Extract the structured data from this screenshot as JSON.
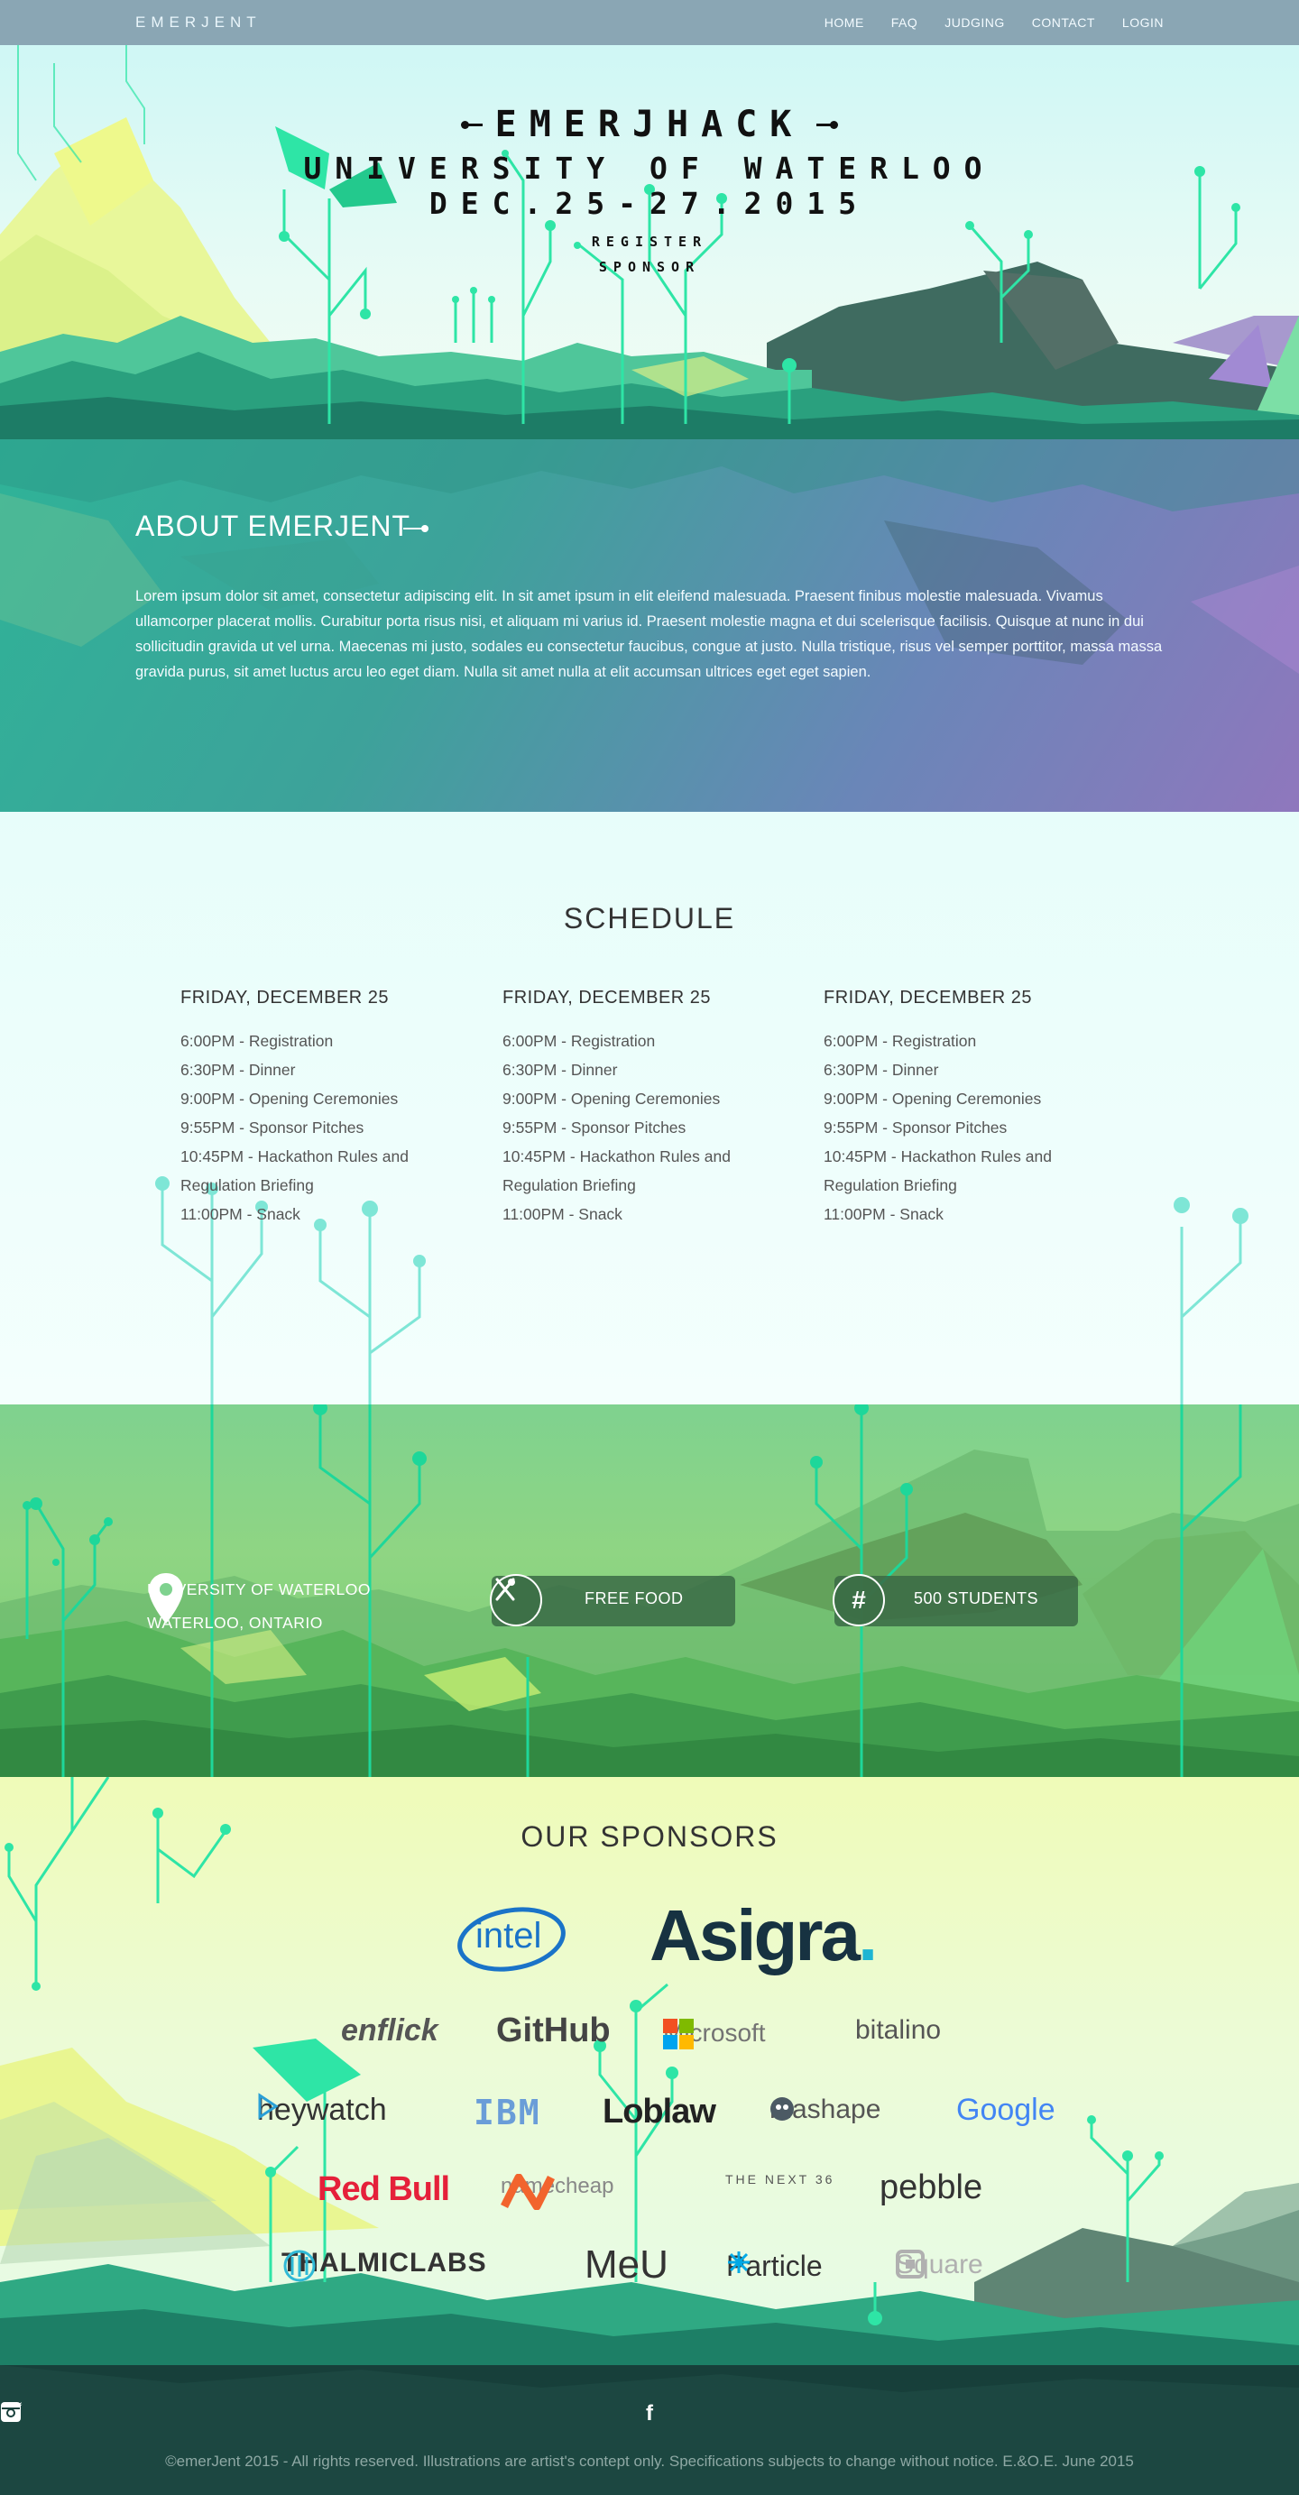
{
  "nav": {
    "brand": "EMERJENT",
    "items": [
      {
        "label": "HOME"
      },
      {
        "label": "FAQ"
      },
      {
        "label": "JUDGING"
      },
      {
        "label": "CONTACT"
      },
      {
        "label": "LOGIN"
      }
    ]
  },
  "hero": {
    "title": "EMERJHACK",
    "location": "UNIVERSITY OF WATERLOO",
    "dates": "DEC.25-27.2015",
    "register": "REGISTER",
    "sponsor": "SPONSOR"
  },
  "about": {
    "heading": "ABOUT EMERJENT",
    "body": "Lorem ipsum dolor sit amet, consectetur adipiscing elit. In sit amet ipsum in elit eleifend malesuada. Praesent finibus molestie malesuada. Vivamus ullamcorper placerat mollis. Curabitur porta risus nisi, et aliquam mi varius id. Praesent molestie magna et dui scelerisque facilisis. Quisque at nunc in dui sollicitudin gravida ut vel urna. Maecenas mi justo, sodales eu consectetur faucibus, congue at justo. Nulla tristique, risus vel semper porttitor, massa massa gravida purus, sit amet luctus arcu leo eget diam. Nulla sit amet nulla at elit accumsan ultrices eget eget sapien."
  },
  "schedule": {
    "heading": "SCHEDULE",
    "days": [
      {
        "title": "FRIDAY, DECEMBER 25",
        "events": [
          "6:00PM - Registration",
          "6:30PM - Dinner",
          "9:00PM - Opening Ceremonies",
          "9:55PM - Sponsor Pitches",
          "10:45PM - Hackathon Rules and Regulation Briefing",
          "11:00PM - Snack"
        ]
      },
      {
        "title": "FRIDAY, DECEMBER 25",
        "events": [
          "6:00PM - Registration",
          "6:30PM - Dinner",
          "9:00PM - Opening Ceremonies",
          "9:55PM - Sponsor Pitches",
          "10:45PM - Hackathon Rules and Regulation Briefing",
          "11:00PM - Snack"
        ]
      },
      {
        "title": "FRIDAY, DECEMBER 25",
        "events": [
          "6:00PM - Registration",
          "6:30PM - Dinner",
          "9:00PM - Opening Ceremonies",
          "9:55PM - Sponsor Pitches",
          "10:45PM - Hackathon Rules and Regulation Briefing",
          "11:00PM - Snack"
        ]
      }
    ]
  },
  "info": {
    "location_line1": "UNIVERSITY OF WATERLOO",
    "location_line2": "WATERLOO, ONTARIO",
    "food_label": "FREE FOOD",
    "students_label": "500 STUDENTS",
    "location_icon": "map-pin-icon",
    "food_icon": "fork-knife-icon",
    "students_icon": "hashtag-icon",
    "students_symbol": "#"
  },
  "sponsors": {
    "heading": "OUR SPONSORS",
    "names": {
      "intel": "intel",
      "asigra": "Asigra",
      "enflick": "enflick",
      "github": "GitHub",
      "microsoft": "Microsoft",
      "bitalino": "bitalino",
      "heywatch": "heywatch",
      "ibm": "IBM",
      "loblaw": "Loblaw",
      "mashape": "mashape",
      "google": "Google",
      "redbull": "Red Bull",
      "namecheap": "namecheap",
      "thenext36": "THE NEXT 36",
      "pebble": "pebble",
      "thalmic": "THALMICLABS",
      "meu": "MeU",
      "particle": "Particle",
      "square": "Square"
    }
  },
  "footer": {
    "social": [
      {
        "name": "twitter-icon",
        "glyph": "🐦"
      },
      {
        "name": "facebook-icon",
        "glyph": "f"
      },
      {
        "name": "instagram-icon",
        "glyph": "◘"
      }
    ],
    "copyright": "©emerJent 2015 - All rights reserved. Illustrations are artist's contept only. Specifications subjects to change without notice. E.&O.E. June 2015"
  },
  "colors": {
    "nav_bg": "#8aa6b4",
    "accent_mint": "#2ee5a6",
    "about_start": "#2fb398",
    "about_end": "#8f77bd",
    "info_green": "#7fd28f",
    "footer_bg": "#173f3a"
  }
}
